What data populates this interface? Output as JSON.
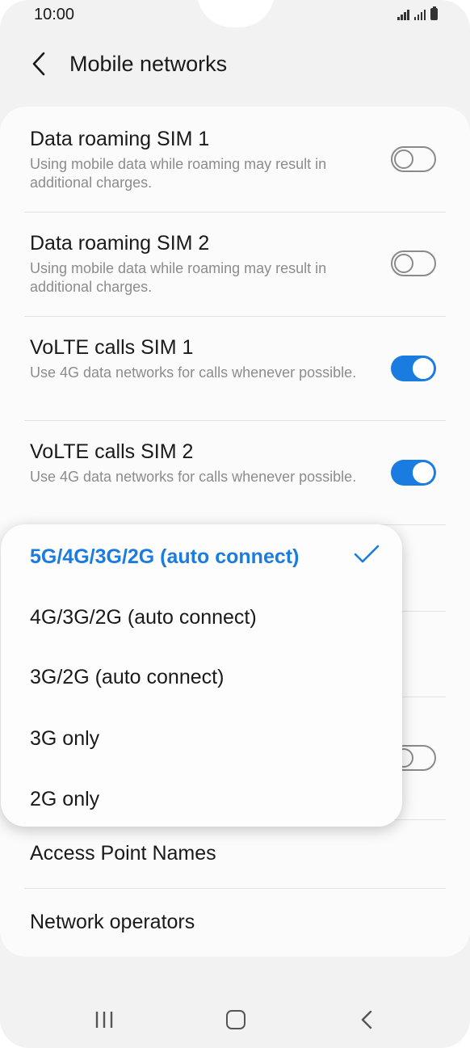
{
  "status_bar": {
    "time": "10:00"
  },
  "header": {
    "title": "Mobile networks"
  },
  "settings": [
    {
      "title": "Data roaming SIM 1",
      "subtitle": "Using mobile data while roaming may result in additional charges.",
      "toggle": "off"
    },
    {
      "title": "Data roaming SIM 2",
      "subtitle": "Using mobile data while roaming may result in additional charges.",
      "toggle": "off"
    },
    {
      "title": "VoLTE calls SIM 1",
      "subtitle": "Use 4G data networks for calls whenever possible.",
      "toggle": "on"
    },
    {
      "title": "VoLTE calls SIM 2",
      "subtitle": "Use 4G data networks for calls whenever possible.",
      "toggle": "on"
    }
  ],
  "lower_items": [
    {
      "title": "Access Point Names"
    },
    {
      "title": "Network operators"
    }
  ],
  "network_mode_menu": {
    "selected_index": 0,
    "options": [
      "5G/4G/3G/2G (auto connect)",
      "4G/3G/2G (auto connect)",
      "3G/2G (auto connect)",
      "3G only",
      "2G only"
    ]
  },
  "colors": {
    "accent": "#1a7ce0",
    "background": "#f2f2f2",
    "card": "#fbfbfb"
  },
  "nav_bar": {
    "icons": [
      "recent-apps-icon",
      "home-icon",
      "back-icon"
    ]
  }
}
